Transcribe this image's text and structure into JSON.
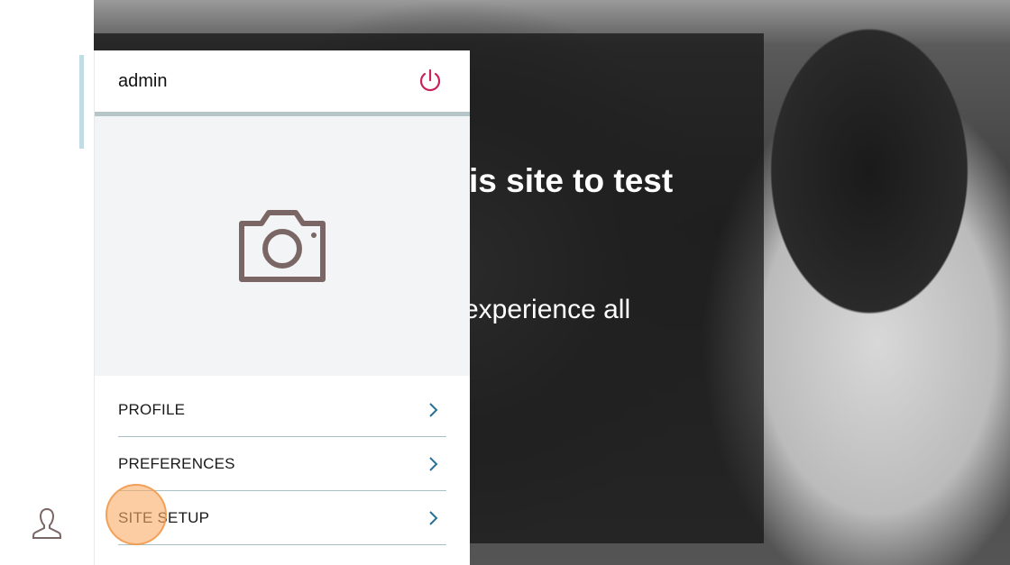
{
  "hero": {
    "title_fragment": "is site to test",
    "subtitle_fragment": "experience all"
  },
  "menu": {
    "username": "admin",
    "items": [
      {
        "label": "PROFILE"
      },
      {
        "label": "PREFERENCES"
      },
      {
        "label": "SITE SETUP"
      }
    ]
  },
  "colors": {
    "power": "#c8235a",
    "chevron": "#2a6f97",
    "camera": "#7a6664"
  }
}
